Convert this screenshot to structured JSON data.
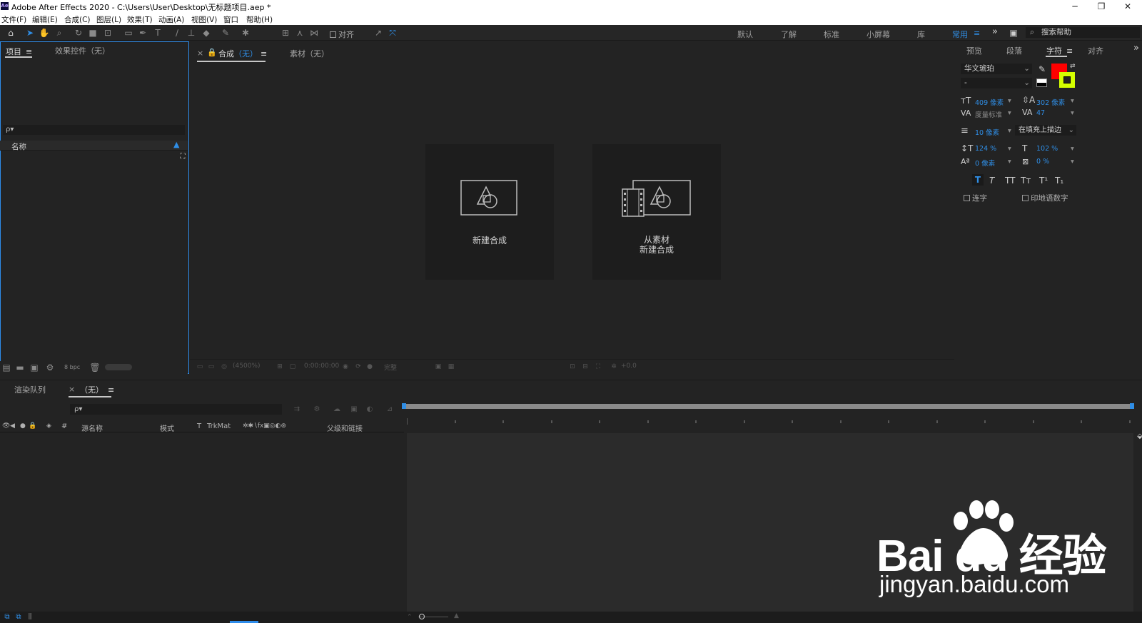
{
  "window": {
    "title": "Adobe After Effects 2020 - C:\\Users\\User\\Desktop\\无标题项目.aep *",
    "logo_text": "Ae",
    "minimize": "─",
    "restore": "❐",
    "close": "✕"
  },
  "menu": [
    "文件(F)",
    "编辑(E)",
    "合成(C)",
    "图层(L)",
    "效果(T)",
    "动画(A)",
    "视图(V)",
    "窗口",
    "帮助(H)"
  ],
  "toolbar": {
    "align_label": "对齐",
    "workspaces": [
      "默认",
      "了解",
      "标准",
      "小屏幕",
      "库",
      "常用"
    ],
    "active_workspace": "常用",
    "overflow": "»",
    "search_help_placeholder": "搜索帮助"
  },
  "project_panel": {
    "tabs": [
      "项目",
      "效果控件（无）"
    ],
    "search_placeholder": "ρ▾",
    "column_name": "名称",
    "bpc": "8 bpc"
  },
  "composition_panel": {
    "tab_comp": "合成",
    "tab_comp_value": "（无）",
    "tab_footage": "素材（无）",
    "close": "×",
    "new_comp_label": "新建合成",
    "from_footage_line1": "从素材",
    "from_footage_line2": "新建合成",
    "footer": {
      "zoom": "(4500%)",
      "timecode": "0:00:00:00",
      "resolution": "完整",
      "exposure": "+0.0"
    }
  },
  "character_panel": {
    "tabs": [
      "预览",
      "段落",
      "字符",
      "对齐"
    ],
    "active_tab": "字符",
    "overflow": "»",
    "font_family": "华文琥珀",
    "font_style": "-",
    "font_size": "409 像素",
    "leading": "302 像素",
    "kerning": "度量标准",
    "tracking": "47",
    "stroke_width": "10 像素",
    "stroke_mode": "在填充上描边",
    "vertical_scale": "124 %",
    "horizontal_scale": "102 %",
    "baseline_shift": "0 像素",
    "tsume": "0 %",
    "style_buttons": [
      "T",
      "T",
      "TT",
      "Tт",
      "T¹",
      "T₁"
    ],
    "ligatures": "连字",
    "hindi_digits": "印地语数字",
    "fill_color": "#ff0000",
    "stroke_color": "#d4ff00"
  },
  "timeline_panel": {
    "tabs": [
      "渲染队列",
      "（无）"
    ],
    "close": "×",
    "search_placeholder": "ρ▾",
    "columns": [
      "#",
      "源名称",
      "模式",
      "T",
      "TrkMat",
      "父级和链接"
    ]
  },
  "watermark": {
    "brand": "Bai du 经验",
    "url": "jingyan.baidu.com"
  },
  "colors": {
    "accent_blue": "#2d8ceb"
  }
}
